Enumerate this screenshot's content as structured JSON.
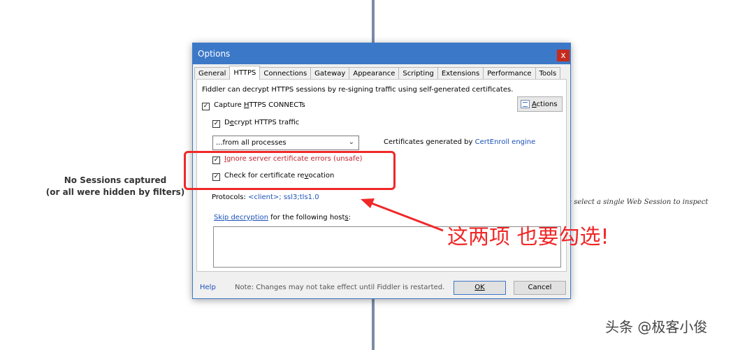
{
  "background": {
    "no_sessions_line1": "No Sessions captured",
    "no_sessions_line2": "(or all were hidden by filters)",
    "inspect_hint": "e select a single Web Session to inspect"
  },
  "dialog": {
    "title": "Options",
    "close_glyph": "x",
    "tabs": [
      {
        "label": "General"
      },
      {
        "label": "HTTPS"
      },
      {
        "label": "Connections"
      },
      {
        "label": "Gateway"
      },
      {
        "label": "Appearance"
      },
      {
        "label": "Scripting"
      },
      {
        "label": "Extensions"
      },
      {
        "label": "Performance"
      },
      {
        "label": "Tools"
      }
    ],
    "active_tab": "HTTPS",
    "https": {
      "description": "Fiddler can decrypt HTTPS sessions by re-signing traffic using self-generated certificates.",
      "capture_pre": "Capture ",
      "capture_u": "H",
      "capture_post": "TTPS CONNECTs",
      "capture_checked": true,
      "decrypt_pre": "D",
      "decrypt_u": "e",
      "decrypt_post": "crypt HTTPS traffic",
      "decrypt_checked": true,
      "actions_u": "A",
      "actions_post": "ctions",
      "process_select": "...from all processes",
      "cert_prefix": "Certificates generated by ",
      "cert_engine": "CertEnroll engine",
      "ignore_u": "I",
      "ignore_post": "gnore server certificate errors (unsafe)",
      "ignore_checked": true,
      "revoke_pre": "Check for certificate re",
      "revoke_u": "v",
      "revoke_post": "ocation",
      "revoke_checked": true,
      "protocols_label": "Protocols: ",
      "protocols_value": "<client>; ssl3;tls1.0",
      "skip_link": "Skip decryption",
      "skip_post_pre": " for the following host",
      "skip_post_u": "s",
      "skip_post_end": ":",
      "hosts_value": ""
    },
    "footer": {
      "help": "Help",
      "note": "Note: Changes may not take effect until Fiddler is restarted.",
      "ok_label": "OK",
      "cancel_label": "Cancel"
    }
  },
  "annotation": {
    "text": "这两项 也要勾选!",
    "color": "#f02828"
  },
  "watermark": "头条 @极客小俊",
  "check_glyph": "✓"
}
